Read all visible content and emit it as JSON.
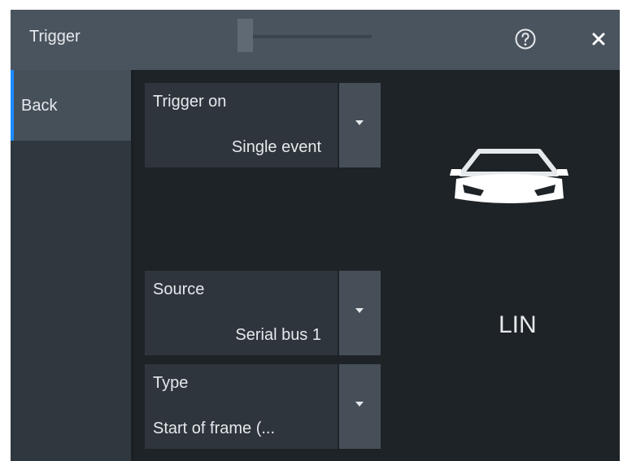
{
  "dialog": {
    "title": "Trigger",
    "help_icon": "help-icon",
    "close_icon": "close-icon"
  },
  "sidebar": {
    "back_label": "Back"
  },
  "fields": {
    "trigger_on": {
      "label": "Trigger on",
      "value": "Single event"
    },
    "source": {
      "label": "Source",
      "value": "Serial bus 1"
    },
    "type": {
      "label": "Type",
      "value": "Start of frame (..."
    }
  },
  "protocol": {
    "icon": "car-icon",
    "label": "LIN"
  },
  "colors": {
    "titlebar": "#4a545e",
    "background": "#1e2328",
    "sidebar": "#30383f",
    "field": "#2e353c",
    "field_arrow": "#464f58",
    "accent": "#1a8cff",
    "text": "#e6e9ec"
  }
}
